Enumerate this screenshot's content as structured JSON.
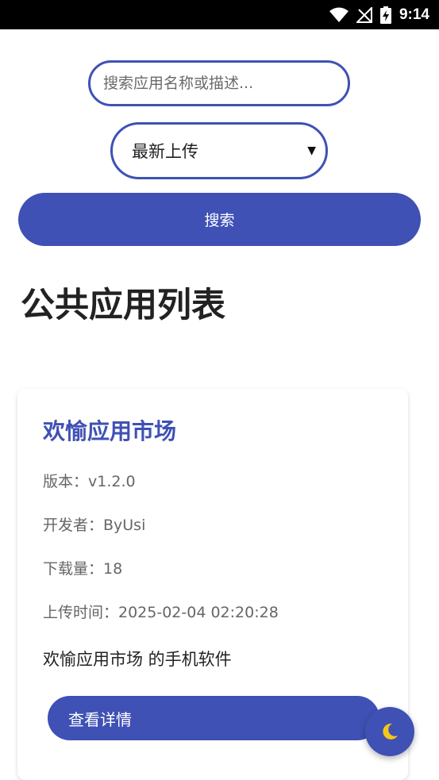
{
  "status_bar": {
    "time": "9:14",
    "icons": [
      "wifi-icon",
      "no-signal-icon",
      "battery-charging-icon"
    ]
  },
  "search": {
    "placeholder": "搜索应用名称或描述...",
    "value": ""
  },
  "sort": {
    "selected": "最新上传"
  },
  "search_button": {
    "label": "搜索"
  },
  "page": {
    "title": "公共应用列表"
  },
  "apps": [
    {
      "name": "欢愉应用市场",
      "version": "版本：v1.2.0",
      "developer": "开发者：ByUsi",
      "downloads": "下载量：18",
      "upload_time": "上传时间：2025-02-04 02:20:28",
      "description": "欢愉应用市场 的手机软件",
      "detail_label": "查看详情"
    }
  ],
  "theme_toggle": {
    "icon": "moon-icon"
  },
  "colors": {
    "accent": "#3f51b5",
    "moon": "#f5c518"
  }
}
